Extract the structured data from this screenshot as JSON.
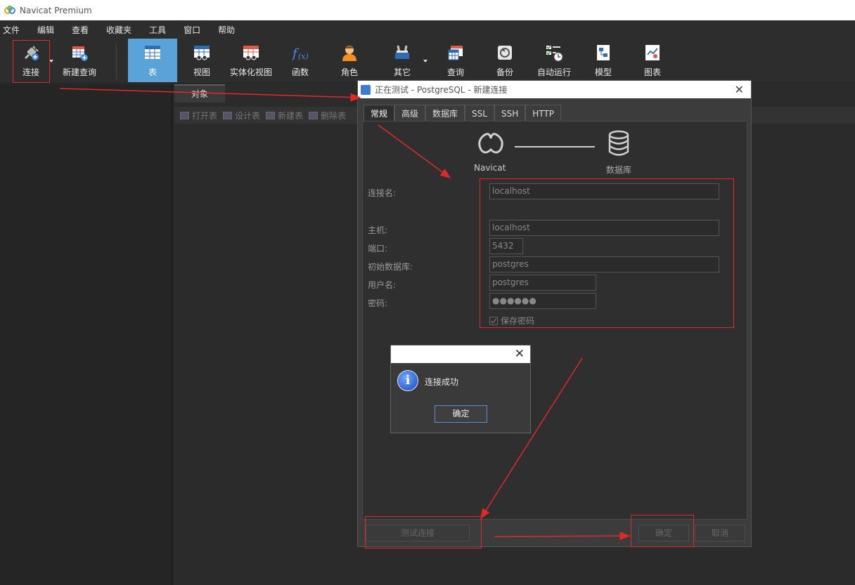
{
  "app": {
    "title": "Navicat Premium"
  },
  "menu": [
    "文件",
    "编辑",
    "查看",
    "收藏夹",
    "工具",
    "窗口",
    "帮助"
  ],
  "toolbar": {
    "connect": "连接",
    "new_query": "新建查询",
    "table": "表",
    "view": "视图",
    "mat_view": "实体化视图",
    "function": "函数",
    "role": "角色",
    "other": "其它",
    "query": "查询",
    "backup": "备份",
    "auto_run": "自动运行",
    "model": "模型",
    "chart": "图表"
  },
  "object_tab": "对象",
  "object_actions": {
    "open": "打开表",
    "design": "设计表",
    "new": "新建表",
    "delete": "删除表"
  },
  "dialog": {
    "title": "正在测试 - PostgreSQL - 新建连接",
    "tabs": [
      "常规",
      "高级",
      "数据库",
      "SSL",
      "SSH",
      "HTTP"
    ],
    "navicat_label": "Navicat",
    "db_label": "数据库",
    "fields": {
      "conn_name_label": "连接名:",
      "conn_name_value": "localhost",
      "host_label": "主机:",
      "host_value": "localhost",
      "port_label": "端口:",
      "port_value": "5432",
      "initdb_label": "初始数据库:",
      "initdb_value": "postgres",
      "user_label": "用户名:",
      "user_value": "postgres",
      "password_label": "密码:",
      "password_value": "●●●●●●"
    },
    "save_password": "保存密码",
    "test_button": "测试连接",
    "ok_button": "确定",
    "cancel_button": "取消"
  },
  "popup": {
    "message": "连接成功",
    "ok": "确定"
  },
  "colors": {
    "accent": "#5aa3d8",
    "annotation": "#e02a2a"
  }
}
